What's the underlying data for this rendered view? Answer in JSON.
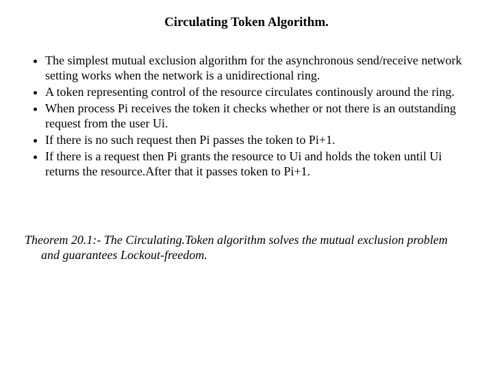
{
  "title": "Circulating Token Algorithm.",
  "bullets": [
    "The simplest mutual exclusion algorithm for the asynchronous send/receive network setting works when the network is a unidirectional ring.",
    " A token representing control of the resource circulates continously around the ring.",
    "When process Pi receives the token it checks whether or not there is an outstanding request from the user Ui.",
    "If there is no such request then Pi passes the token to Pi+1.",
    "If there is a request then Pi grants the resource to Ui and holds the token until Ui returns the resource.After that it passes token to Pi+1."
  ],
  "theorem": "Theorem 20.1:- The Circulating.Token algorithm solves the mutual exclusion problem and guarantees Lockout-freedom."
}
